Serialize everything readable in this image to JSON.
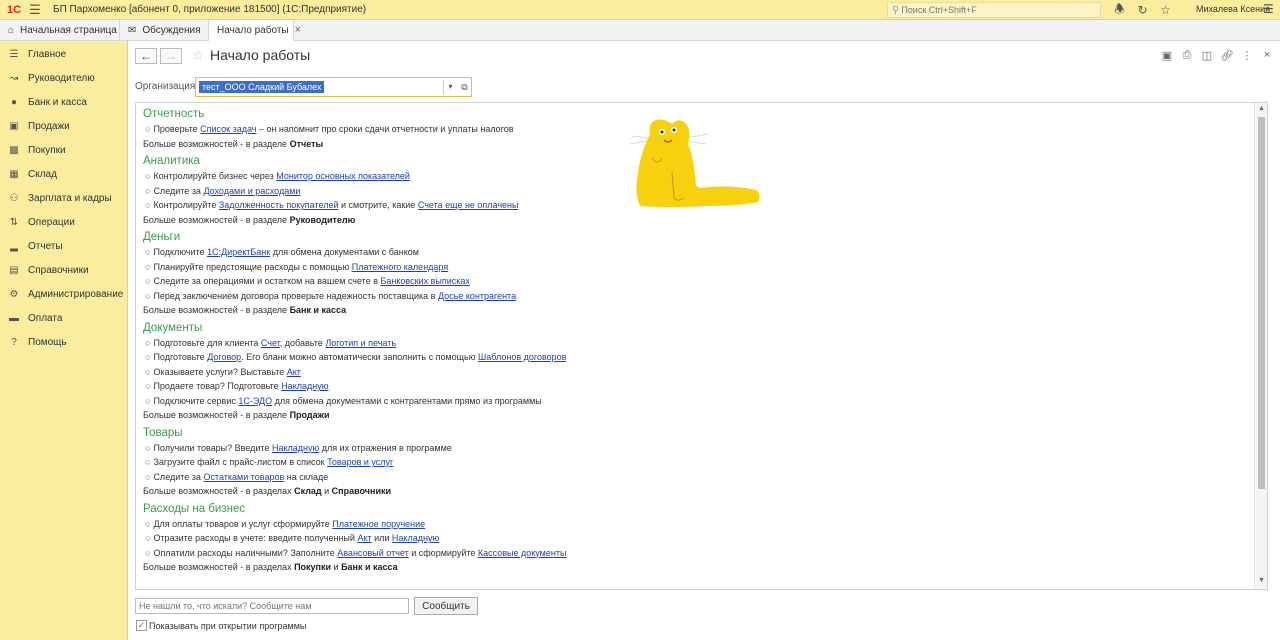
{
  "topbar": {
    "logo": "1С",
    "title": "БП Пархоменко [абонент 0, приложение 181500]  (1С:Предприятие)",
    "search_placeholder": "Поиск Ctrl+Shift+F",
    "user": "Михалева Ксения",
    "icons": [
      "bell-icon",
      "history-icon",
      "star-icon",
      "menu-icon"
    ]
  },
  "tabs": [
    {
      "label": "Начальная страница",
      "icon": "home-icon"
    },
    {
      "label": "Обсуждения",
      "icon": "chat-icon"
    },
    {
      "label": "Начало работы",
      "icon": "",
      "active": true
    }
  ],
  "sidebar": {
    "items": [
      {
        "label": "Главное",
        "icon": "list-icon"
      },
      {
        "label": "Руководителю",
        "icon": "trend-icon"
      },
      {
        "label": "Банк и касса",
        "icon": "coin-icon"
      },
      {
        "label": "Продажи",
        "icon": "bag-icon"
      },
      {
        "label": "Покупки",
        "icon": "cart-icon"
      },
      {
        "label": "Склад",
        "icon": "box-icon"
      },
      {
        "label": "Зарплата и кадры",
        "icon": "people-icon"
      },
      {
        "label": "Операции",
        "icon": "ops-icon"
      },
      {
        "label": "Отчеты",
        "icon": "chart-icon"
      },
      {
        "label": "Справочники",
        "icon": "book-icon"
      },
      {
        "label": "Администрирование",
        "icon": "gear-icon"
      },
      {
        "label": "Оплата",
        "icon": "card-icon"
      },
      {
        "label": "Помощь",
        "icon": "help-icon"
      }
    ]
  },
  "page": {
    "title": "Начало работы",
    "org_label": "Организация:",
    "org_value": " тест_ООО Сладкий Бубалех"
  },
  "sections": [
    {
      "title": "Отчетность",
      "rows": [
        [
          {
            "t": "Проверьте "
          },
          {
            "l": "Список задач"
          },
          {
            "t": " – он напомнит про сроки сдачи отчетности и уплаты налогов"
          }
        ]
      ],
      "more_prefix": "Больше возможностей - в разделе ",
      "more_bold1": "Отчеты",
      "more_mid": "",
      "more_bold2": ""
    },
    {
      "title": "Аналитика",
      "rows": [
        [
          {
            "t": "Контролируйте бизнес через "
          },
          {
            "l": "Монитор основных показателей"
          }
        ],
        [
          {
            "t": "Следите за "
          },
          {
            "l": "Доходами и расходами"
          }
        ],
        [
          {
            "t": "Контролируйте "
          },
          {
            "l": "Задолженность покупателей"
          },
          {
            "t": " и смотрите, какие "
          },
          {
            "l": "Счета еще не оплачены"
          }
        ]
      ],
      "more_prefix": "Больше возможностей - в разделе ",
      "more_bold1": "Руководителю",
      "more_mid": "",
      "more_bold2": ""
    },
    {
      "title": "Деньги",
      "rows": [
        [
          {
            "t": "Подключите "
          },
          {
            "l": "1С:ДиректБанк"
          },
          {
            "t": " для обмена документами с банком"
          }
        ],
        [
          {
            "t": "Планируйте предстоящие расходы с помощью "
          },
          {
            "l": "Платежного календаря"
          }
        ],
        [
          {
            "t": "Следите за операциями и остатком на вашем счете в  "
          },
          {
            "l": "Банковских выписках"
          }
        ],
        [
          {
            "t": "Перед заключением договора проверьте надежность поставщика в "
          },
          {
            "l": "Досье контрагента"
          }
        ]
      ],
      "more_prefix": "Больше возможностей - в разделе ",
      "more_bold1": "Банк и касса",
      "more_mid": "",
      "more_bold2": ""
    },
    {
      "title": "Документы",
      "rows": [
        [
          {
            "t": "Подготовьте для клиента "
          },
          {
            "l": "Счет"
          },
          {
            "t": ", добавьте "
          },
          {
            "l": "Логотип и печать"
          }
        ],
        [
          {
            "t": "Подготовьте "
          },
          {
            "l": "Договор"
          },
          {
            "t": ". Его бланк можно автоматически заполнить с помощью "
          },
          {
            "l": "Шаблонов договоров"
          }
        ],
        [
          {
            "t": "Оказываете услуги? Выставьте "
          },
          {
            "l": "Акт"
          }
        ],
        [
          {
            "t": "Продаете товар? Подготовьте "
          },
          {
            "l": "Накладную"
          }
        ],
        [
          {
            "t": "Подключите сервис "
          },
          {
            "l": "1С-ЭДО"
          },
          {
            "t": " для обмена документами с контрагентами прямо из программы"
          }
        ]
      ],
      "more_prefix": "Больше возможностей - в разделе ",
      "more_bold1": "Продажи",
      "more_mid": "",
      "more_bold2": ""
    },
    {
      "title": "Товары",
      "rows": [
        [
          {
            "t": "Получили товары? Введите "
          },
          {
            "l": "Накладную"
          },
          {
            "t": " для их отражения в программе"
          }
        ],
        [
          {
            "t": "Загрузите файл с прайс-листом в список "
          },
          {
            "l": "Товаров и услуг"
          }
        ],
        [
          {
            "t": "Следите за "
          },
          {
            "l": "Остатками товаров"
          },
          {
            "t": " на складе"
          }
        ]
      ],
      "more_prefix": "Больше возможностей - в разделах ",
      "more_bold1": "Склад",
      "more_mid": " и ",
      "more_bold2": "Справочники"
    },
    {
      "title": "Расходы на бизнес",
      "rows": [
        [
          {
            "t": "Для оплаты товаров и услуг сформируйте "
          },
          {
            "l": "Платежное поручение"
          }
        ],
        [
          {
            "t": "Отразите расходы в учете: введите полученный "
          },
          {
            "l": "Акт"
          },
          {
            "t": " или "
          },
          {
            "l": "Накладную"
          }
        ],
        [
          {
            "t": "Оплатили расходы наличными? Заполните "
          },
          {
            "l": "Авансовый отчет"
          },
          {
            "t": " и сформируйте "
          },
          {
            "l": "Кассовые документы"
          }
        ]
      ],
      "more_prefix": "Больше возможностей - в разделах ",
      "more_bold1": "Покупки",
      "more_mid": " и ",
      "more_bold2": "Банк и касса"
    }
  ],
  "footer": {
    "ask_placeholder": "Не нашли то, что искали? Сообщите нам",
    "ask_button": "Сообщить",
    "checkbox_label": "Показывать при открытии программы",
    "checkbox_checked": true
  },
  "colors": {
    "accent_yellow": "#fbed9e",
    "section_green": "#3a9c4a",
    "link_blue": "#1f3fb4",
    "selection_blue": "#3f6fc5"
  }
}
